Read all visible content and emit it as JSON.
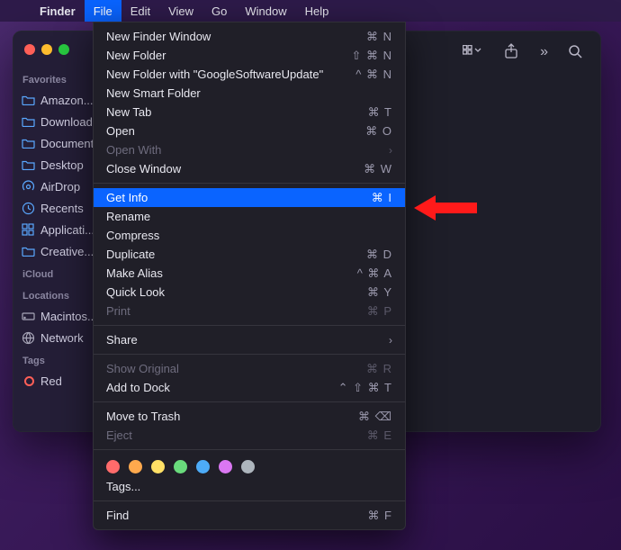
{
  "menubar": {
    "app": "Finder",
    "items": [
      "File",
      "Edit",
      "View",
      "Go",
      "Window",
      "Help"
    ],
    "open_index": 0
  },
  "sidebar": {
    "sections": [
      {
        "heading": "Favorites",
        "items": [
          {
            "icon": "folder",
            "label": "Amazon..."
          },
          {
            "icon": "folder",
            "label": "Download"
          },
          {
            "icon": "folder",
            "label": "Document"
          },
          {
            "icon": "folder",
            "label": "Desktop"
          },
          {
            "icon": "airdrop",
            "label": "AirDrop"
          },
          {
            "icon": "clock",
            "label": "Recents"
          },
          {
            "icon": "grid",
            "label": "Applicati..."
          },
          {
            "icon": "folder",
            "label": "Creative..."
          }
        ]
      },
      {
        "heading": "iCloud",
        "items": []
      },
      {
        "heading": "Locations",
        "items": [
          {
            "icon": "disk",
            "label": "Macintos.."
          },
          {
            "icon": "globe",
            "label": "Network"
          }
        ]
      },
      {
        "heading": "Tags",
        "items": [
          {
            "icon": "tag",
            "label": "Red",
            "color": "#ff5f57"
          }
        ]
      }
    ]
  },
  "dropdown": {
    "rows": [
      {
        "label": "New Finder Window",
        "shortcut": "⌘ N"
      },
      {
        "label": "New Folder",
        "shortcut": "⇧ ⌘ N"
      },
      {
        "label": "New Folder with \"GoogleSoftwareUpdate\"",
        "shortcut": "^ ⌘ N"
      },
      {
        "label": "New Smart Folder",
        "shortcut": ""
      },
      {
        "label": "New Tab",
        "shortcut": "⌘ T"
      },
      {
        "label": "Open",
        "shortcut": "⌘ O"
      },
      {
        "label": "Open With",
        "submenu": true,
        "disabled": true
      },
      {
        "label": "Close Window",
        "shortcut": "⌘ W"
      },
      {
        "sep": true
      },
      {
        "label": "Get Info",
        "shortcut": "⌘  I",
        "highlight": true
      },
      {
        "label": "Rename",
        "shortcut": ""
      },
      {
        "label": "Compress",
        "shortcut": ""
      },
      {
        "label": "Duplicate",
        "shortcut": "⌘ D"
      },
      {
        "label": "Make Alias",
        "shortcut": "^ ⌘ A"
      },
      {
        "label": "Quick Look",
        "shortcut": "⌘ Y"
      },
      {
        "label": "Print",
        "shortcut": "⌘ P",
        "disabled": true
      },
      {
        "sep": true
      },
      {
        "label": "Share",
        "submenu": true
      },
      {
        "sep": true
      },
      {
        "label": "Show Original",
        "shortcut": "⌘ R",
        "disabled": true
      },
      {
        "label": "Add to Dock",
        "shortcut": "⌃ ⇧ ⌘ T"
      },
      {
        "sep": true
      },
      {
        "label": "Move to Trash",
        "shortcut": "⌘ ⌫"
      },
      {
        "label": "Eject",
        "shortcut": "⌘ E",
        "disabled": true
      },
      {
        "sep": true
      },
      {
        "tags": true,
        "colors": [
          "#ff6b6b",
          "#ffa94d",
          "#ffe066",
          "#69db7c",
          "#4dabf7",
          "#da77f2",
          "#adb5bd"
        ]
      },
      {
        "label": "Tags...",
        "shortcut": ""
      },
      {
        "sep": true
      },
      {
        "label": "Find",
        "shortcut": "⌘ F"
      }
    ]
  },
  "toolbar": {
    "view_icon": "grid-menu",
    "share_icon": "share",
    "more_icon": "chevrons",
    "search_icon": "search"
  }
}
